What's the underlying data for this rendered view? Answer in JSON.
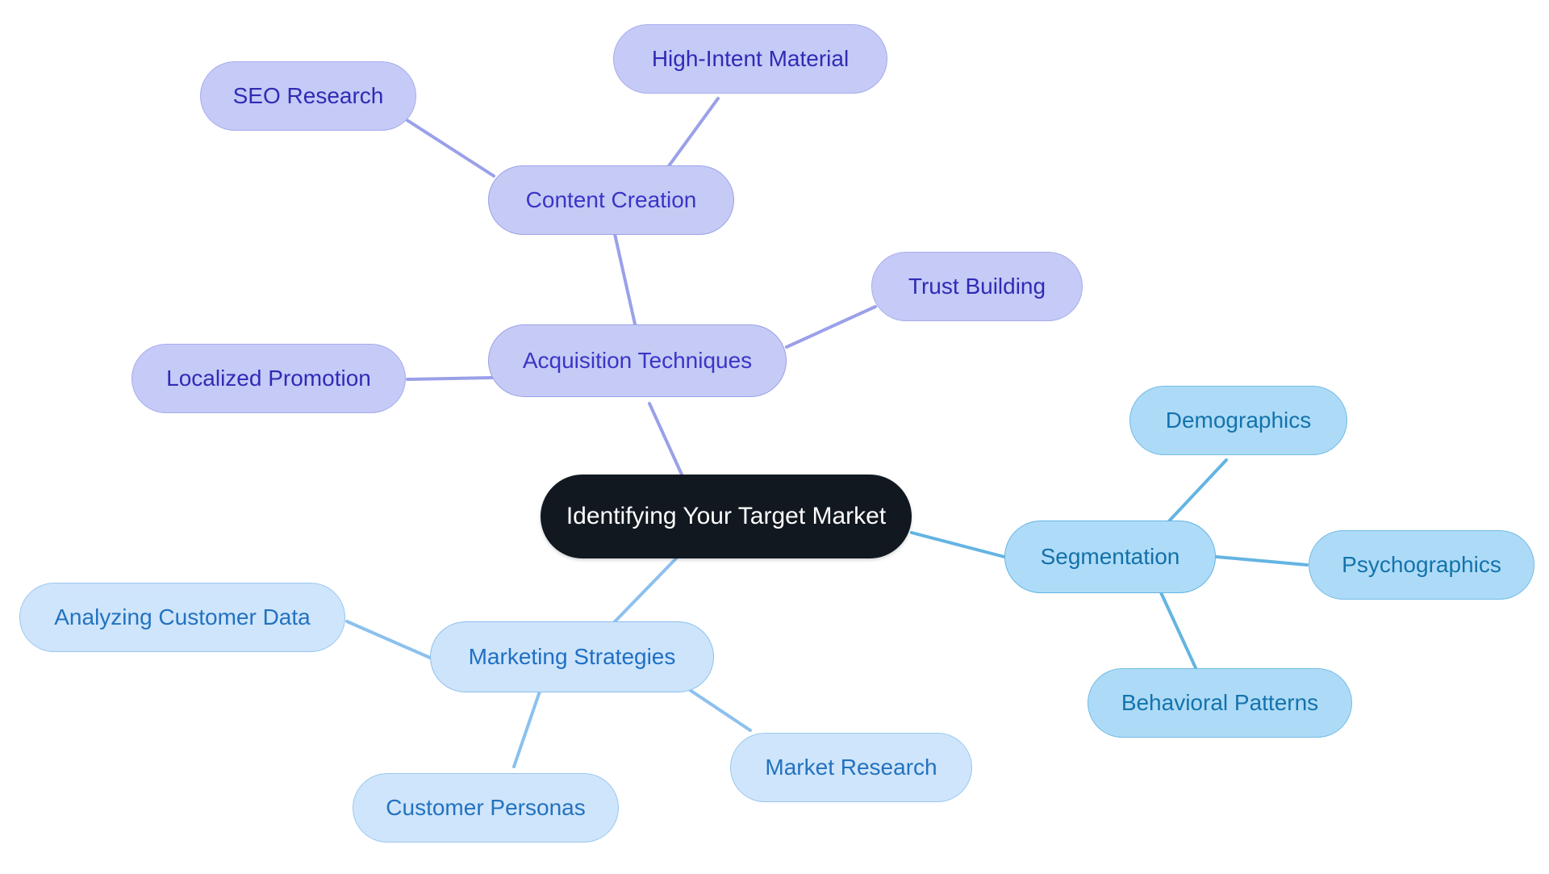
{
  "diagram": {
    "type": "mind-map",
    "title": "Identifying Your Target Market",
    "background_color": "#ffffff",
    "palette": {
      "root_fill": "#111820",
      "root_text": "#ffffff",
      "purple_fill": "#c6cbf6",
      "purple_text": "#3b35c6",
      "purple_edge": "#9aa0e8",
      "blue_fill": "#aedcf8",
      "blue_text": "#1570a8",
      "blue_edge": "#64b4e2",
      "lightblue_fill": "#cde4fb",
      "lightblue_text": "#1f6fc4",
      "lightblue_edge": "#8cc0ee"
    }
  },
  "nodes": {
    "root": {
      "label": "Identifying Your Target Market"
    },
    "acquisition_techniques": {
      "label": "Acquisition Techniques"
    },
    "content_creation": {
      "label": "Content Creation"
    },
    "seo_research": {
      "label": "SEO Research"
    },
    "high_intent_material": {
      "label": "High-Intent Material"
    },
    "trust_building": {
      "label": "Trust Building"
    },
    "localized_promotion": {
      "label": "Localized Promotion"
    },
    "segmentation": {
      "label": "Segmentation"
    },
    "demographics": {
      "label": "Demographics"
    },
    "psychographics": {
      "label": "Psychographics"
    },
    "behavioral_patterns": {
      "label": "Behavioral Patterns"
    },
    "marketing_strategies": {
      "label": "Marketing Strategies"
    },
    "analyzing_customer_data": {
      "label": "Analyzing Customer Data"
    },
    "customer_personas": {
      "label": "Customer Personas"
    },
    "market_research": {
      "label": "Market Research"
    }
  },
  "hierarchy": [
    {
      "id": "root",
      "label": "Identifying Your Target Market",
      "children": [
        {
          "id": "acquisition_techniques",
          "label": "Acquisition Techniques",
          "children": [
            {
              "id": "content_creation",
              "label": "Content Creation",
              "children": [
                {
                  "id": "seo_research",
                  "label": "SEO Research"
                },
                {
                  "id": "high_intent_material",
                  "label": "High-Intent Material"
                }
              ]
            },
            {
              "id": "trust_building",
              "label": "Trust Building"
            },
            {
              "id": "localized_promotion",
              "label": "Localized Promotion"
            }
          ]
        },
        {
          "id": "segmentation",
          "label": "Segmentation",
          "children": [
            {
              "id": "demographics",
              "label": "Demographics"
            },
            {
              "id": "psychographics",
              "label": "Psychographics"
            },
            {
              "id": "behavioral_patterns",
              "label": "Behavioral Patterns"
            }
          ]
        },
        {
          "id": "marketing_strategies",
          "label": "Marketing Strategies",
          "children": [
            {
              "id": "analyzing_customer_data",
              "label": "Analyzing Customer Data"
            },
            {
              "id": "customer_personas",
              "label": "Customer Personas"
            },
            {
              "id": "market_research",
              "label": "Market Research"
            }
          ]
        }
      ]
    }
  ]
}
